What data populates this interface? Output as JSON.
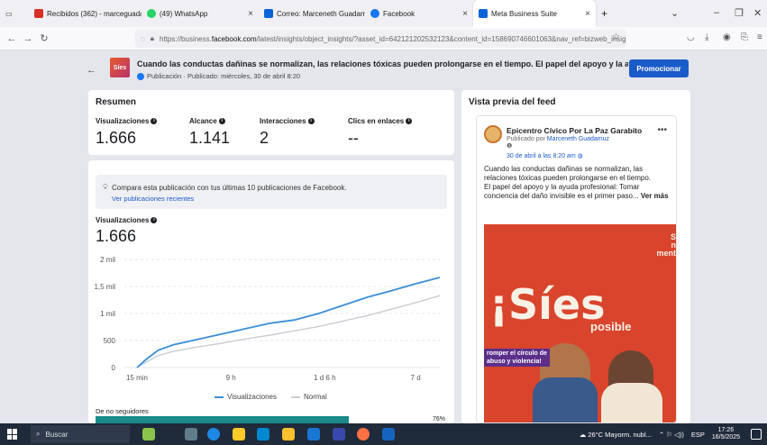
{
  "browser": {
    "tabs": [
      {
        "label": "Recibidos (362) - marceguadan",
        "color": "#d93025"
      },
      {
        "label": "(49) WhatsApp",
        "color": "#25d366"
      },
      {
        "label": "Correo: Marceneth Guadamuz",
        "color": "#0a64d6"
      },
      {
        "label": "Facebook",
        "color": "#1877f2"
      },
      {
        "label": "Meta Business Suite",
        "color": "#0a64d6"
      }
    ],
    "url_prefix": "https://business.",
    "url_domain": "facebook.com",
    "url_rest": "/latest/insights/object_insights/?asset_id=642121202532123&content_id=158690746601063&nav_ref=bizweb_insigh"
  },
  "post": {
    "thumb_text": "Síes",
    "title": "Cuando las conductas dañinas se normalizan, las relaciones tóxicas pueden prolongarse en el tiempo. El papel del apoyo y la ayu...",
    "subtitle": "Publicación · Publicado: miércoles, 30 de abril 8:20",
    "promote_label": "Promocionar"
  },
  "resumen": {
    "title": "Resumen",
    "metrics": [
      {
        "label": "Visualizaciones",
        "value": "1.666"
      },
      {
        "label": "Alcance",
        "value": "1.141"
      },
      {
        "label": "Interacciones",
        "value": "2"
      },
      {
        "label": "Clics en enlaces",
        "value": "--"
      }
    ]
  },
  "compare": {
    "text": "Compara esta publicación con tus últimas 10 publicaciones de Facebook.",
    "link": "Ver publicaciones recientes"
  },
  "visualizaciones": {
    "label": "Visualizaciones",
    "value": "1.666"
  },
  "chart_data": {
    "type": "line",
    "x_ticks": [
      "15 min",
      "9 h",
      "1 d 6 h",
      "7 d"
    ],
    "y_ticks": [
      "0",
      "500",
      "1 mil",
      "1,5 mil",
      "2 mil"
    ],
    "ylim": [
      0,
      2000
    ],
    "series": [
      {
        "name": "Visualizaciones",
        "color": "#3a8fd8",
        "x": [
          0,
          0.03,
          0.07,
          0.12,
          0.2,
          0.28,
          0.36,
          0.44,
          0.52,
          0.6,
          0.68,
          0.76,
          0.84,
          0.92,
          1.0
        ],
        "values": [
          0,
          150,
          320,
          420,
          520,
          620,
          720,
          820,
          880,
          1000,
          1150,
          1300,
          1420,
          1550,
          1666
        ]
      },
      {
        "name": "Normal",
        "color": "#c8ccd2",
        "x": [
          0,
          0.03,
          0.07,
          0.12,
          0.2,
          0.28,
          0.36,
          0.44,
          0.52,
          0.6,
          0.68,
          0.76,
          0.84,
          0.92,
          1.0
        ],
        "values": [
          0,
          100,
          220,
          300,
          380,
          450,
          530,
          600,
          680,
          760,
          860,
          960,
          1080,
          1200,
          1330
        ]
      }
    ]
  },
  "non_followers": {
    "label": "De no seguidores",
    "percent": 76,
    "display": "76%"
  },
  "feed": {
    "title": "Vista previa del feed",
    "page_name": "Epicentro Cívico Por La Paz Garabito",
    "published_by_prefix": "Publicado por",
    "published_by": "Marceneth Guadamuz",
    "time": "30 de abril a las 8:20 am",
    "body": "Cuando las conductas dañinas se normalizan, las relaciones tóxicas pueden prolongarse en el tiempo.",
    "body2": "El papel del apoyo y la ayuda profesional: Tomar conciencia del daño invisible es el primer paso...",
    "see_more": "Ver más",
    "image_big": "¡Síes",
    "image_small": "posible",
    "image_logo_1": "Sa",
    "image_logo_2": "na",
    "image_logo_3": "mente",
    "image_caption_1": "romper el círculo de",
    "image_caption_2": "abuso y violencia!"
  },
  "taskbar": {
    "search_placeholder": "Buscar",
    "weather": "26°C Mayorm. nubl...",
    "lang": "ESP",
    "time": "17:26",
    "date": "16/5/2025"
  }
}
